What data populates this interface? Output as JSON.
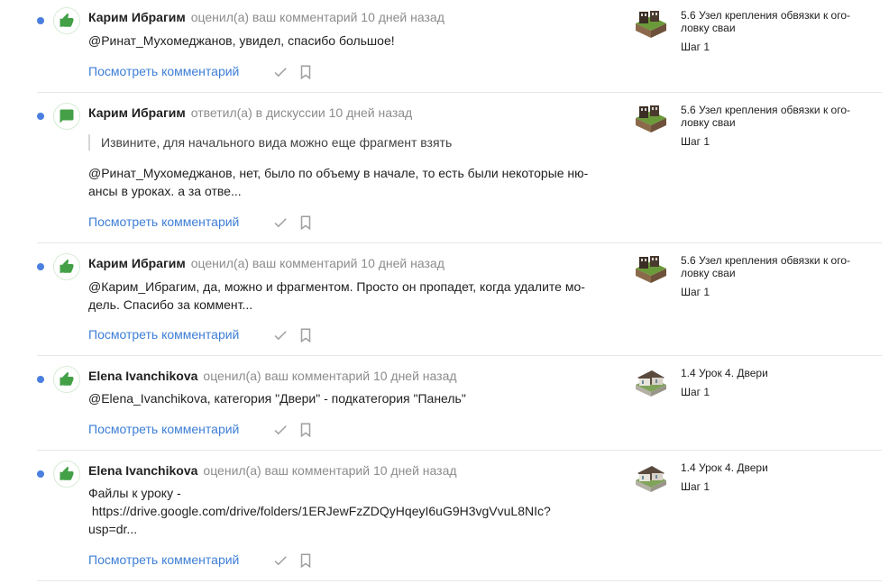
{
  "notifications": [
    {
      "icon": "thumbs-up-icon",
      "author": "Карим Ибрагим",
      "action": "оценил(а) ваш комментарий 10 дней назад",
      "quote": "",
      "body": "@Ринат_Мухомеджанов, увидел, спасибо большое!",
      "link": "Посмотреть комментарий",
      "lesson_title": "5.6 Узел крепления обвязки к ого-\nловку сваи",
      "lesson_step": "Шаг 1",
      "thumb": "pile-node-model"
    },
    {
      "icon": "comment-icon",
      "author": "Карим Ибрагим",
      "action": "ответил(а) в дискуссии 10 дней назад",
      "quote": "Извините, для начального вида можно еще фрагмент взять",
      "body": "@Ринат_Мухомеджанов, нет, было по объему в начале, то есть были некоторые ню-\nансы в уроках. а за отве...",
      "link": "Посмотреть комментарий",
      "lesson_title": "5.6 Узел крепления обвязки к ого-\nловку сваи",
      "lesson_step": "Шаг 1",
      "thumb": "pile-node-model"
    },
    {
      "icon": "thumbs-up-icon",
      "author": "Карим Ибрагим",
      "action": "оценил(а) ваш комментарий 10 дней назад",
      "quote": "",
      "body": "@Карим_Ибрагим, да, можно и фрагментом. Просто он пропадет, когда удалите мо-\nдель. Спасибо за коммент...",
      "link": "Посмотреть комментарий",
      "lesson_title": "5.6 Узел крепления обвязки к ого-\nловку сваи",
      "lesson_step": "Шаг 1",
      "thumb": "pile-node-model"
    },
    {
      "icon": "thumbs-up-icon",
      "author": "Elena Ivanchikova",
      "action": "оценил(а) ваш комментарий 10 дней назад",
      "quote": "",
      "body": "@Elena_Ivanchikova, категория \"Двери\" - подкатегория \"Панель\"",
      "link": "Посмотреть комментарий",
      "lesson_title": "1.4 Урок 4. Двери",
      "lesson_step": "Шаг 1",
      "thumb": "house-model"
    },
    {
      "icon": "thumbs-up-icon",
      "author": "Elena Ivanchikova",
      "action": "оценил(а) ваш комментарий 10 дней назад",
      "quote": "",
      "body": "Файлы к уроку -\n https://drive.google.com/drive/folders/1ERJewFzZDQyHqeyI6uG9H3vgVvuL8NIc?\nusp=dr...",
      "link": "Посмотреть комментарий",
      "lesson_title": "1.4 Урок 4. Двери",
      "lesson_step": "Шаг 1",
      "thumb": "house-model"
    }
  ],
  "colors": {
    "accent_green": "#43a047",
    "link_blue": "#3d7ed6",
    "unread_dot": "#4a7fe0",
    "muted_text": "#8c8c8c"
  }
}
